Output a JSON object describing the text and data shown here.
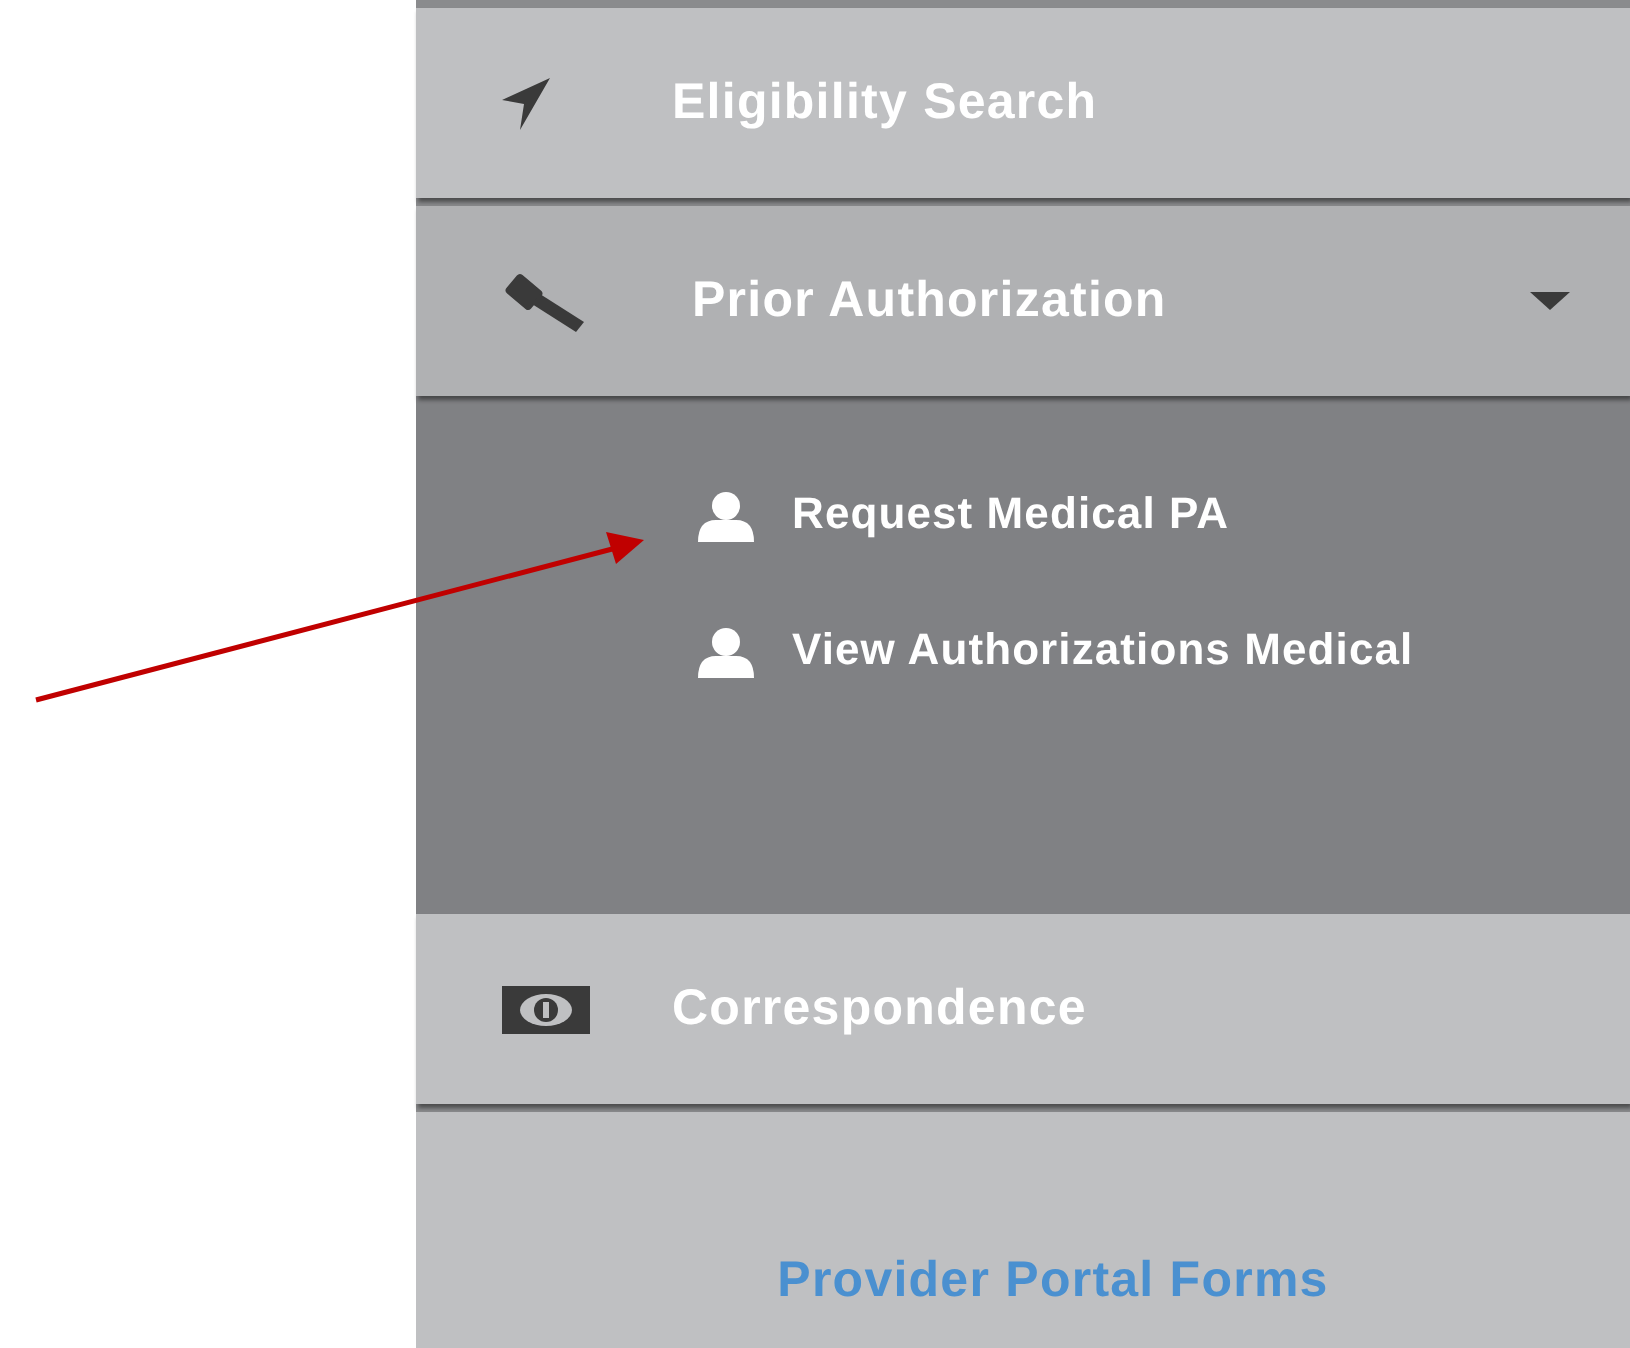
{
  "nav": [
    {
      "kind": "link",
      "label": "Eligibility Search"
    },
    {
      "kind": "group",
      "label": "Prior Authorization",
      "expanded": true,
      "children": [
        {
          "label": "Request Medical PA"
        },
        {
          "label": "View Authorizations Medical"
        }
      ]
    },
    {
      "kind": "link",
      "label": "Correspondence"
    }
  ],
  "footer_link": "Provider Portal Forms"
}
